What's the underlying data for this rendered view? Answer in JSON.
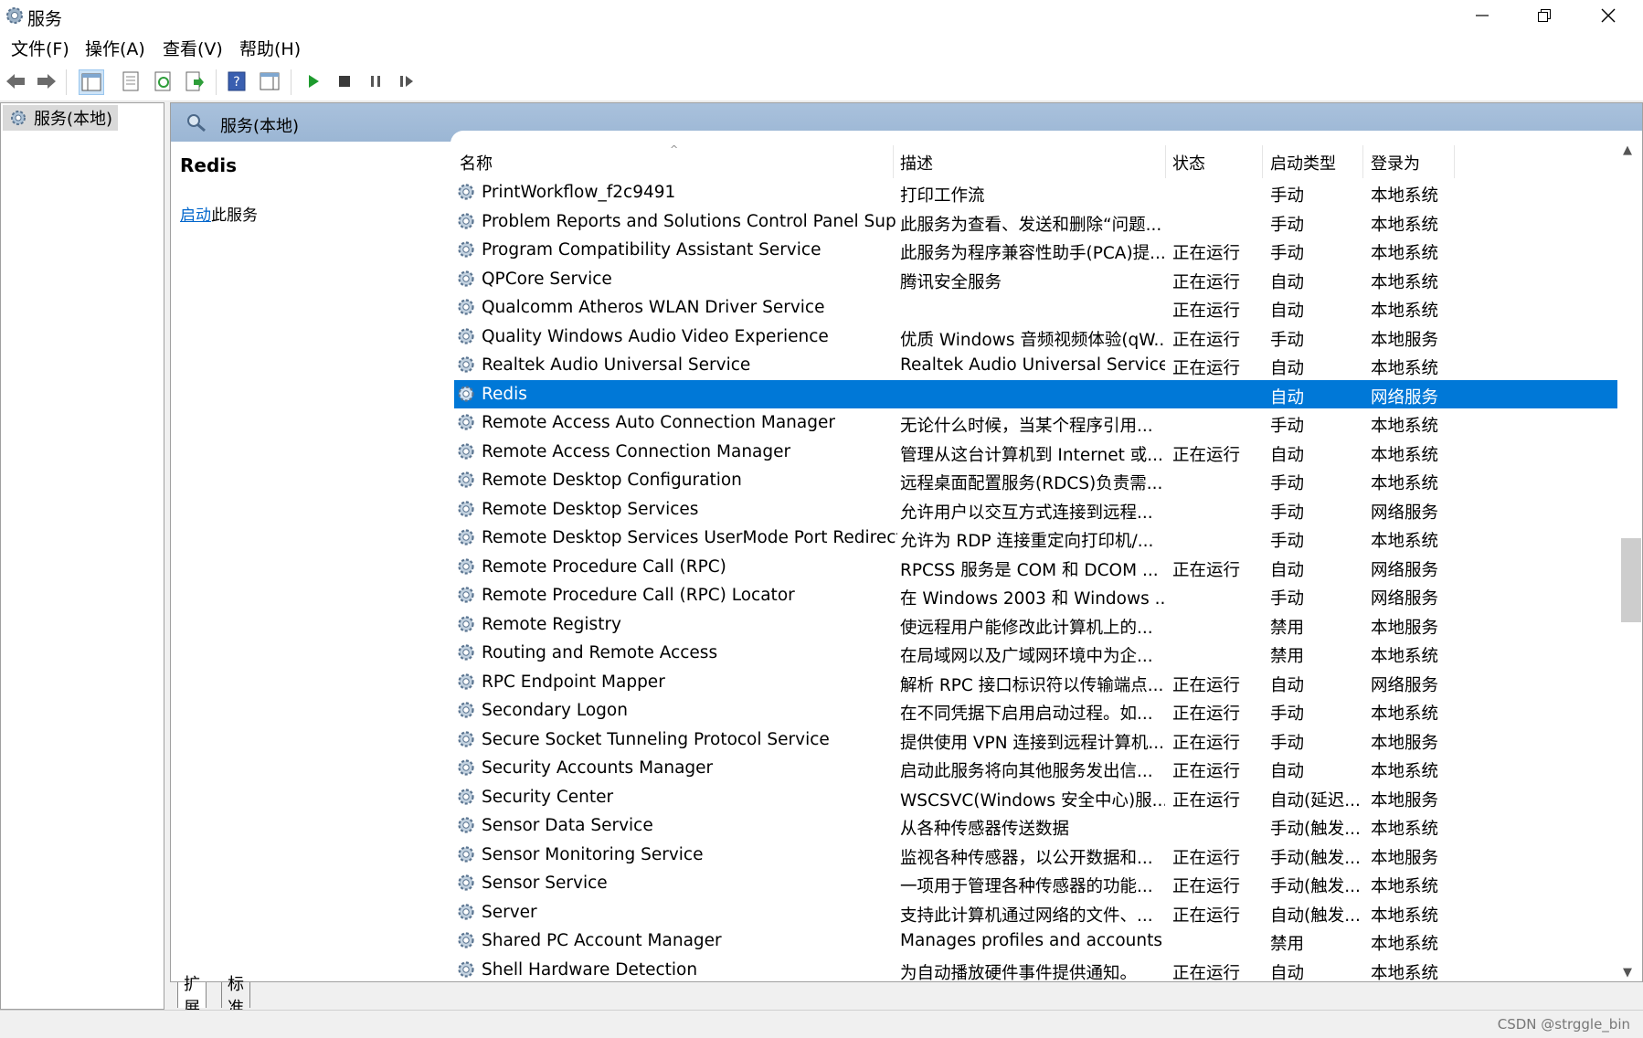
{
  "window": {
    "title": "服务"
  },
  "menu": [
    "文件(F)",
    "操作(A)",
    "查看(V)",
    "帮助(H)"
  ],
  "tree": {
    "root_label": "服务(本地)"
  },
  "header": {
    "title": "服务(本地)"
  },
  "extended": {
    "service_name": "Redis",
    "start_link": "启动",
    "start_suffix": "此服务"
  },
  "columns": {
    "name": "名称",
    "desc": "描述",
    "status": "状态",
    "startup": "启动类型",
    "logon": "登录为"
  },
  "services": [
    {
      "name": "PrintWorkflow_f2c9491",
      "desc": "打印工作流",
      "status": "",
      "startup": "手动",
      "logon": "本地系统"
    },
    {
      "name": "Problem Reports and Solutions Control Panel Support",
      "desc": "此服务为查看、发送和删除“问题...",
      "status": "",
      "startup": "手动",
      "logon": "本地系统"
    },
    {
      "name": "Program Compatibility Assistant Service",
      "desc": "此服务为程序兼容性助手(PCA)提...",
      "status": "正在运行",
      "startup": "手动",
      "logon": "本地系统"
    },
    {
      "name": "QPCore Service",
      "desc": "腾讯安全服务",
      "status": "正在运行",
      "startup": "自动",
      "logon": "本地系统"
    },
    {
      "name": "Qualcomm Atheros WLAN Driver Service",
      "desc": "",
      "status": "正在运行",
      "startup": "自动",
      "logon": "本地系统"
    },
    {
      "name": "Quality Windows Audio Video Experience",
      "desc": "优质 Windows 音频视频体验(qW...",
      "status": "正在运行",
      "startup": "手动",
      "logon": "本地服务"
    },
    {
      "name": "Realtek Audio Universal Service",
      "desc": "Realtek Audio Universal Service",
      "status": "正在运行",
      "startup": "自动",
      "logon": "本地系统"
    },
    {
      "name": "Redis",
      "desc": "",
      "status": "",
      "startup": "自动",
      "logon": "网络服务",
      "selected": true
    },
    {
      "name": "Remote Access Auto Connection Manager",
      "desc": "无论什么时候，当某个程序引用...",
      "status": "",
      "startup": "手动",
      "logon": "本地系统"
    },
    {
      "name": "Remote Access Connection Manager",
      "desc": "管理从这台计算机到 Internet 或...",
      "status": "正在运行",
      "startup": "自动",
      "logon": "本地系统"
    },
    {
      "name": "Remote Desktop Configuration",
      "desc": "远程桌面配置服务(RDCS)负责需...",
      "status": "",
      "startup": "手动",
      "logon": "本地系统"
    },
    {
      "name": "Remote Desktop Services",
      "desc": "允许用户以交互方式连接到远程...",
      "status": "",
      "startup": "手动",
      "logon": "网络服务"
    },
    {
      "name": "Remote Desktop Services UserMode Port Redirector",
      "desc": "允许为 RDP 连接重定向打印机/...",
      "status": "",
      "startup": "手动",
      "logon": "本地系统"
    },
    {
      "name": "Remote Procedure Call (RPC)",
      "desc": "RPCSS 服务是 COM 和 DCOM ...",
      "status": "正在运行",
      "startup": "自动",
      "logon": "网络服务"
    },
    {
      "name": "Remote Procedure Call (RPC) Locator",
      "desc": "在 Windows 2003 和 Windows ...",
      "status": "",
      "startup": "手动",
      "logon": "网络服务"
    },
    {
      "name": "Remote Registry",
      "desc": "使远程用户能修改此计算机上的...",
      "status": "",
      "startup": "禁用",
      "logon": "本地服务"
    },
    {
      "name": "Routing and Remote Access",
      "desc": "在局域网以及广域网环境中为企...",
      "status": "",
      "startup": "禁用",
      "logon": "本地系统"
    },
    {
      "name": "RPC Endpoint Mapper",
      "desc": "解析 RPC 接口标识符以传输端点...",
      "status": "正在运行",
      "startup": "自动",
      "logon": "网络服务"
    },
    {
      "name": "Secondary Logon",
      "desc": "在不同凭据下启用启动过程。如...",
      "status": "正在运行",
      "startup": "手动",
      "logon": "本地系统"
    },
    {
      "name": "Secure Socket Tunneling Protocol Service",
      "desc": "提供使用 VPN 连接到远程计算机...",
      "status": "正在运行",
      "startup": "手动",
      "logon": "本地服务"
    },
    {
      "name": "Security Accounts Manager",
      "desc": "启动此服务将向其他服务发出信...",
      "status": "正在运行",
      "startup": "自动",
      "logon": "本地系统"
    },
    {
      "name": "Security Center",
      "desc": "WSCSVC(Windows 安全中心)服...",
      "status": "正在运行",
      "startup": "自动(延迟...",
      "logon": "本地服务"
    },
    {
      "name": "Sensor Data Service",
      "desc": "从各种传感器传送数据",
      "status": "",
      "startup": "手动(触发...",
      "logon": "本地系统"
    },
    {
      "name": "Sensor Monitoring Service",
      "desc": "监视各种传感器，以公开数据和...",
      "status": "正在运行",
      "startup": "手动(触发...",
      "logon": "本地服务"
    },
    {
      "name": "Sensor Service",
      "desc": "一项用于管理各种传感器的功能...",
      "status": "正在运行",
      "startup": "手动(触发...",
      "logon": "本地系统"
    },
    {
      "name": "Server",
      "desc": "支持此计算机通过网络的文件、...",
      "status": "正在运行",
      "startup": "自动(触发...",
      "logon": "本地系统"
    },
    {
      "name": "Shared PC Account Manager",
      "desc": "Manages profiles and accounts o...",
      "status": "",
      "startup": "禁用",
      "logon": "本地系统"
    },
    {
      "name": "Shell Hardware Detection",
      "desc": "为自动播放硬件事件提供通知。",
      "status": "正在运行",
      "startup": "自动",
      "logon": "本地系统"
    }
  ],
  "tabs": [
    "扩展",
    "标准"
  ],
  "watermark": "CSDN @strggle_bin"
}
